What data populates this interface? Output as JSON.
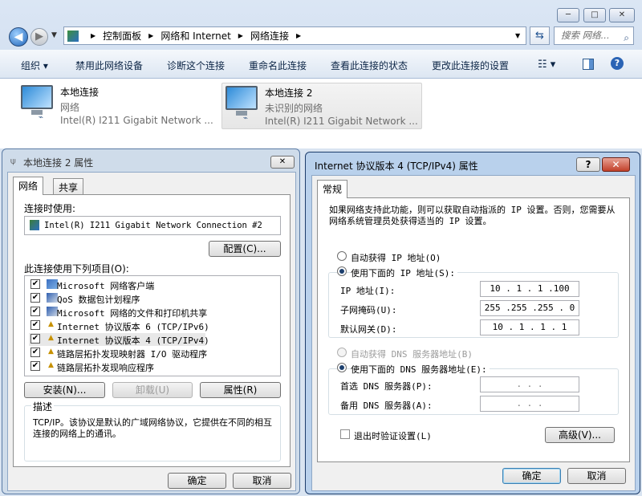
{
  "explorer": {
    "window_buttons": [
      "─",
      "□",
      "✕"
    ],
    "breadcrumb": [
      "控制面板",
      "网络和 Internet",
      "网络连接"
    ],
    "search_placeholder": "搜索 网络...",
    "toolbar": [
      "组织 ▾",
      "禁用此网络设备",
      "诊断这个连接",
      "重命名此连接",
      "查看此连接的状态",
      "更改此连接的设置"
    ],
    "connections": [
      {
        "name": "本地连接",
        "status": "网络",
        "adapter": "Intel(R) I211 Gigabit Network ..."
      },
      {
        "name": "本地连接 2",
        "status": "未识别的网络",
        "adapter": "Intel(R) I211 Gigabit Network ..."
      }
    ]
  },
  "left_dialog": {
    "title": "本地连接 2 属性",
    "close": "✕",
    "tabs": [
      "网络",
      "共享"
    ],
    "connect_using_label": "连接时使用:",
    "adapter": "Intel(R) I211 Gigabit Network Connection #2",
    "configure_btn": "配置(C)...",
    "items_label": "此连接使用下列项目(O):",
    "items": [
      "Microsoft 网络客户端",
      "QoS 数据包计划程序",
      "Microsoft 网络的文件和打印机共享",
      "Internet 协议版本 6 (TCP/IPv6)",
      "Internet 协议版本 4 (TCP/IPv4)",
      "链路层拓扑发现映射器 I/O 驱动程序",
      "链路层拓扑发现响应程序"
    ],
    "install_btn": "安装(N)...",
    "uninstall_btn": "卸载(U)",
    "properties_btn": "属性(R)",
    "desc_label": "描述",
    "desc_text": "TCP/IP。该协议是默认的广域网络协议，它提供在不同的相互连接的网络上的通讯。",
    "ok": "确定",
    "cancel": "取消"
  },
  "right_dialog": {
    "title": "Internet 协议版本 4 (TCP/IPv4) 属性",
    "help": "?",
    "close": "✕",
    "tab": "常规",
    "intro": "如果网络支持此功能，则可以获取自动指派的 IP 设置。否则，您需要从网络系统管理员处获得适当的 IP 设置。",
    "auto_ip": "自动获得 IP 地址(O)",
    "manual_ip": "使用下面的 IP 地址(S):",
    "ip_label": "IP 地址(I):",
    "ip_value": "10 . 1 . 1 .100",
    "mask_label": "子网掩码(U):",
    "mask_value": "255 .255 .255 . 0",
    "gw_label": "默认网关(D):",
    "gw_value": "10 . 1 . 1 . 1",
    "auto_dns": "自动获得 DNS 服务器地址(B)",
    "manual_dns": "使用下面的 DNS 服务器地址(E):",
    "dns1_label": "首选 DNS 服务器(P):",
    "dns2_label": "备用 DNS 服务器(A):",
    "dns_empty": ".    .    .",
    "validate": "退出时验证设置(L)",
    "advanced_btn": "高级(V)...",
    "ok": "确定",
    "cancel": "取消"
  }
}
